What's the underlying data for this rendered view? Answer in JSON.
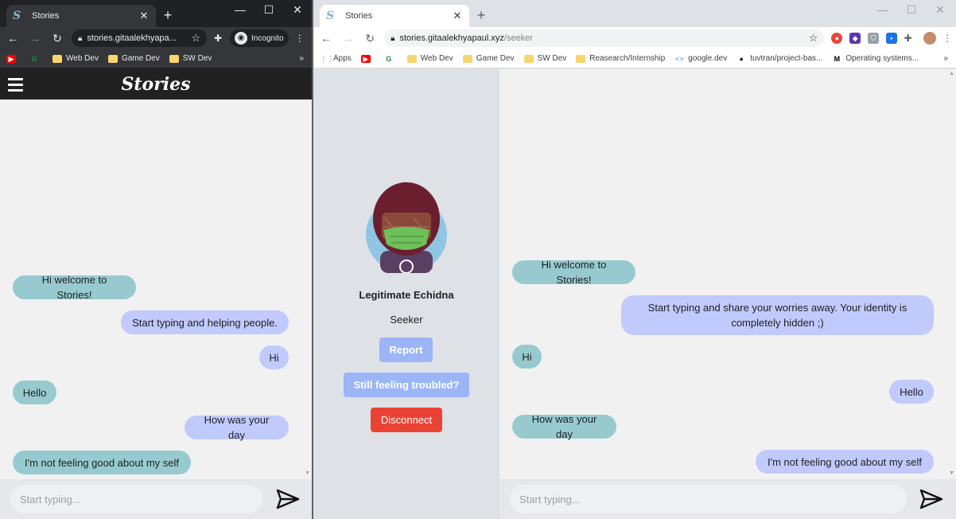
{
  "left_window": {
    "tab": {
      "title": "Stories"
    },
    "url": "stories.gitaalekhyapa...",
    "incognito_label": "Incognito",
    "bookmarks": [
      "Web Dev",
      "Game Dev",
      "SW Dev"
    ],
    "app": {
      "logo": "Stories"
    },
    "messages": [
      {
        "from": "bot",
        "text": "Hi welcome to Stories!"
      },
      {
        "from": "me",
        "text": "Start typing and helping people."
      },
      {
        "from": "me",
        "text": "Hi"
      },
      {
        "from": "bot",
        "text": "Hello"
      },
      {
        "from": "me",
        "text": "How was your day"
      },
      {
        "from": "bot",
        "text": "I'm not feeling good about my self"
      }
    ],
    "input_placeholder": "Start typing..."
  },
  "right_window": {
    "tab": {
      "title": "Stories"
    },
    "url_host": "stories.gitaalekhyapaul.xyz",
    "url_path": "/seeker",
    "bookmarks": [
      "Apps",
      "Web Dev",
      "Game Dev",
      "SW Dev",
      "Reasearch/Internship",
      "google.dev",
      "tuvtran/project-bas...",
      "Operating systems..."
    ],
    "profile": {
      "name": "Legitimate Echidna",
      "role": "Seeker",
      "report_label": "Report",
      "troubled_label": "Still feeling troubled?",
      "disconnect_label": "Disconnect"
    },
    "messages": [
      {
        "from": "bot",
        "text": "Hi welcome to Stories!"
      },
      {
        "from": "me",
        "text": "Start typing and share your worries away. Your identity is completely hidden ;)"
      },
      {
        "from": "bot",
        "text": "Hi"
      },
      {
        "from": "me",
        "text": "Hello"
      },
      {
        "from": "bot",
        "text": "How was your day"
      },
      {
        "from": "me",
        "text": "I'm not feeling good about my self"
      }
    ],
    "input_placeholder": "Start typing..."
  },
  "colors": {
    "bot_bubble": "#97cacf",
    "me_bubble": "#c0cafc",
    "report": "#9bb5f7",
    "disconnect": "#ea4335"
  }
}
